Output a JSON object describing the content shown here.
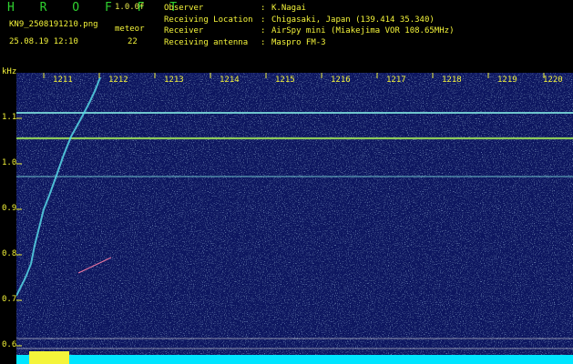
{
  "header": {
    "brand": "H R O F F T",
    "version": "1.0.0f",
    "filename": "KN9_2508191210.png",
    "mode": "meteor",
    "datetime": "25.08.19 12:10",
    "count": "22",
    "fields": [
      {
        "key": "Observer",
        "value": "K.Nagai"
      },
      {
        "key": "Receiving Location",
        "value": "Chigasaki, Japan (139.414 35.340)"
      },
      {
        "key": "Receiver",
        "value": "AirSpy mini (Miakejima VOR 108.65MHz)"
      },
      {
        "key": "Receiving antenna",
        "value": "Maspro FM-3"
      }
    ]
  },
  "axis": {
    "y_unit": "kHz",
    "y_ticks": [
      "1.1",
      "1.0",
      "0.9",
      "0.8",
      "0.7",
      "0.6"
    ],
    "x_ticks": [
      "1211",
      "1212",
      "1213",
      "1214",
      "1215",
      "1216",
      "1217",
      "1218",
      "1219",
      "1220"
    ]
  },
  "colors": {
    "background": "#0a1460",
    "carrier": "#79e3d8",
    "text": "#f4f43a",
    "brand": "#2fd12f",
    "noise_floor": "#00e5ff"
  }
}
